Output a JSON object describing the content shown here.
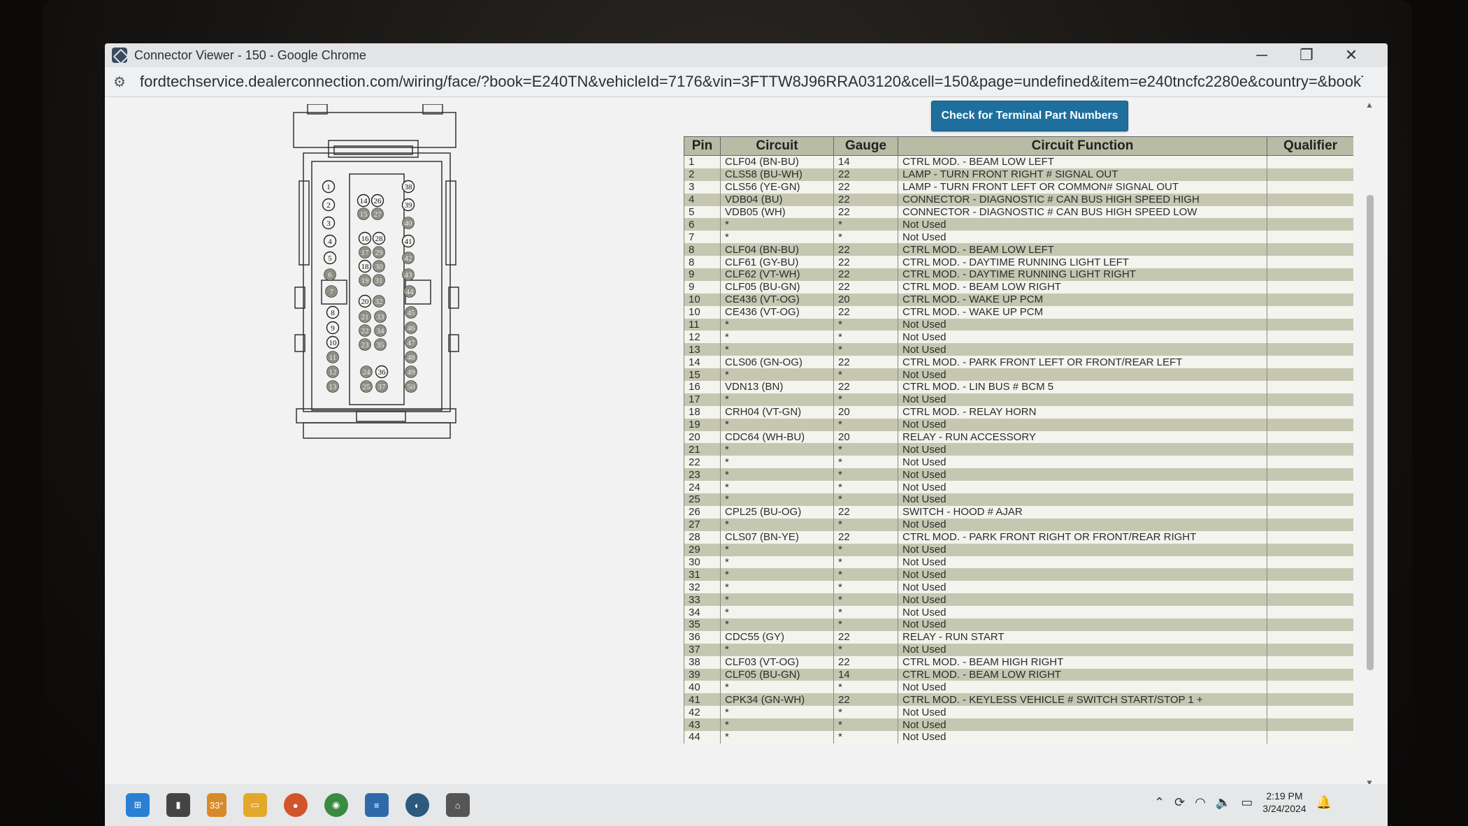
{
  "window": {
    "title": "Connector Viewer - 150 - Google Chrome",
    "minimize": "─",
    "restore": "❐",
    "close": "✕"
  },
  "address": {
    "url": "fordtechservice.dealerconnection.com/wiring/face/?book=E240TN&vehicleId=7176&vin=3FTTW8J96RRA03120&cell=150&page=undefined&item=e240tncfc2280e&country=&bookType=svg&lan..."
  },
  "button": {
    "check_label": "Check for Terminal Part Numbers"
  },
  "table": {
    "headers": [
      "Pin",
      "Circuit",
      "Gauge",
      "Circuit Function",
      "Qualifier"
    ],
    "rows": [
      [
        "1",
        "CLF04 (BN-BU)",
        "14",
        "CTRL MOD. - BEAM LOW LEFT",
        ""
      ],
      [
        "2",
        "CLS58 (BU-WH)",
        "22",
        "LAMP - TURN FRONT RIGHT # SIGNAL OUT",
        ""
      ],
      [
        "3",
        "CLS56 (YE-GN)",
        "22",
        "LAMP - TURN FRONT LEFT OR COMMON# SIGNAL OUT",
        ""
      ],
      [
        "4",
        "VDB04 (BU)",
        "22",
        "CONNECTOR - DIAGNOSTIC # CAN BUS HIGH SPEED HIGH",
        ""
      ],
      [
        "5",
        "VDB05 (WH)",
        "22",
        "CONNECTOR - DIAGNOSTIC # CAN BUS HIGH SPEED LOW",
        ""
      ],
      [
        "6",
        "*",
        "*",
        "Not Used",
        ""
      ],
      [
        "7",
        "*",
        "*",
        "Not Used",
        ""
      ],
      [
        "8",
        "CLF04 (BN-BU)",
        "22",
        "CTRL MOD. - BEAM LOW LEFT",
        ""
      ],
      [
        "8",
        "CLF61 (GY-BU)",
        "22",
        "CTRL MOD. - DAYTIME RUNNING LIGHT LEFT",
        ""
      ],
      [
        "9",
        "CLF62 (VT-WH)",
        "22",
        "CTRL MOD. - DAYTIME RUNNING LIGHT RIGHT",
        ""
      ],
      [
        "9",
        "CLF05 (BU-GN)",
        "22",
        "CTRL MOD. - BEAM LOW RIGHT",
        ""
      ],
      [
        "10",
        "CE436 (VT-OG)",
        "20",
        "CTRL MOD. - WAKE UP PCM",
        ""
      ],
      [
        "10",
        "CE436 (VT-OG)",
        "22",
        "CTRL MOD. - WAKE UP PCM",
        ""
      ],
      [
        "11",
        "*",
        "*",
        "Not Used",
        ""
      ],
      [
        "12",
        "*",
        "*",
        "Not Used",
        ""
      ],
      [
        "13",
        "*",
        "*",
        "Not Used",
        ""
      ],
      [
        "14",
        "CLS06 (GN-OG)",
        "22",
        "CTRL MOD. - PARK FRONT LEFT OR FRONT/REAR LEFT",
        ""
      ],
      [
        "15",
        "*",
        "*",
        "Not Used",
        ""
      ],
      [
        "16",
        "VDN13 (BN)",
        "22",
        "CTRL MOD. - LIN BUS # BCM 5",
        ""
      ],
      [
        "17",
        "*",
        "*",
        "Not Used",
        ""
      ],
      [
        "18",
        "CRH04 (VT-GN)",
        "20",
        "CTRL MOD. - RELAY HORN",
        ""
      ],
      [
        "19",
        "*",
        "*",
        "Not Used",
        ""
      ],
      [
        "20",
        "CDC64 (WH-BU)",
        "20",
        "RELAY - RUN ACCESSORY",
        ""
      ],
      [
        "21",
        "*",
        "*",
        "Not Used",
        ""
      ],
      [
        "22",
        "*",
        "*",
        "Not Used",
        ""
      ],
      [
        "23",
        "*",
        "*",
        "Not Used",
        ""
      ],
      [
        "24",
        "*",
        "*",
        "Not Used",
        ""
      ],
      [
        "25",
        "*",
        "*",
        "Not Used",
        ""
      ],
      [
        "26",
        "CPL25 (BU-OG)",
        "22",
        "SWITCH - HOOD # AJAR",
        ""
      ],
      [
        "27",
        "*",
        "*",
        "Not Used",
        ""
      ],
      [
        "28",
        "CLS07 (BN-YE)",
        "22",
        "CTRL MOD. - PARK FRONT RIGHT OR FRONT/REAR RIGHT",
        ""
      ],
      [
        "29",
        "*",
        "*",
        "Not Used",
        ""
      ],
      [
        "30",
        "*",
        "*",
        "Not Used",
        ""
      ],
      [
        "31",
        "*",
        "*",
        "Not Used",
        ""
      ],
      [
        "32",
        "*",
        "*",
        "Not Used",
        ""
      ],
      [
        "33",
        "*",
        "*",
        "Not Used",
        ""
      ],
      [
        "34",
        "*",
        "*",
        "Not Used",
        ""
      ],
      [
        "35",
        "*",
        "*",
        "Not Used",
        ""
      ],
      [
        "36",
        "CDC55 (GY)",
        "22",
        "RELAY - RUN START",
        ""
      ],
      [
        "37",
        "*",
        "*",
        "Not Used",
        ""
      ],
      [
        "38",
        "CLF03 (VT-OG)",
        "22",
        "CTRL MOD. - BEAM HIGH RIGHT",
        ""
      ],
      [
        "39",
        "CLF05 (BU-GN)",
        "14",
        "CTRL MOD. - BEAM LOW RIGHT",
        ""
      ],
      [
        "40",
        "*",
        "*",
        "Not Used",
        ""
      ],
      [
        "41",
        "CPK34 (GN-WH)",
        "22",
        "CTRL MOD. - KEYLESS VEHICLE # SWITCH START/STOP 1 +",
        ""
      ],
      [
        "42",
        "*",
        "*",
        "Not Used",
        ""
      ],
      [
        "43",
        "*",
        "*",
        "Not Used",
        ""
      ],
      [
        "44",
        "*",
        "*",
        "Not Used",
        ""
      ]
    ]
  },
  "connector": {
    "used_pins": [
      1,
      2,
      3,
      4,
      5,
      8,
      9,
      10,
      14,
      16,
      18,
      20,
      26,
      28,
      36,
      38,
      39,
      41
    ],
    "unused_pins": [
      6,
      7,
      11,
      12,
      13,
      15,
      17,
      19,
      21,
      22,
      23,
      24,
      25,
      27,
      29,
      30,
      31,
      32,
      33,
      34,
      35,
      37,
      40,
      42,
      43,
      44,
      45,
      46,
      47,
      48,
      49,
      50
    ],
    "colors": {
      "used_fill": "#f4f4f0",
      "unused_fill": "#8f8f86"
    }
  },
  "taskbar": {
    "weather": "33°",
    "time": "2:19 PM",
    "date": "3/24/2024",
    "apps": [
      "windows-start-icon",
      "task-view-icon",
      "weather-icon",
      "file-explorer-icon",
      "firefox-icon",
      "chrome-icon",
      "notepad-icon",
      "remote-icon",
      "network-icon"
    ]
  },
  "colors": {
    "button_bg": "#1e6f9e",
    "header_bg": "#b9bba5",
    "row_even": "#c5c7b1",
    "row_odd": "#f4f4ee"
  }
}
